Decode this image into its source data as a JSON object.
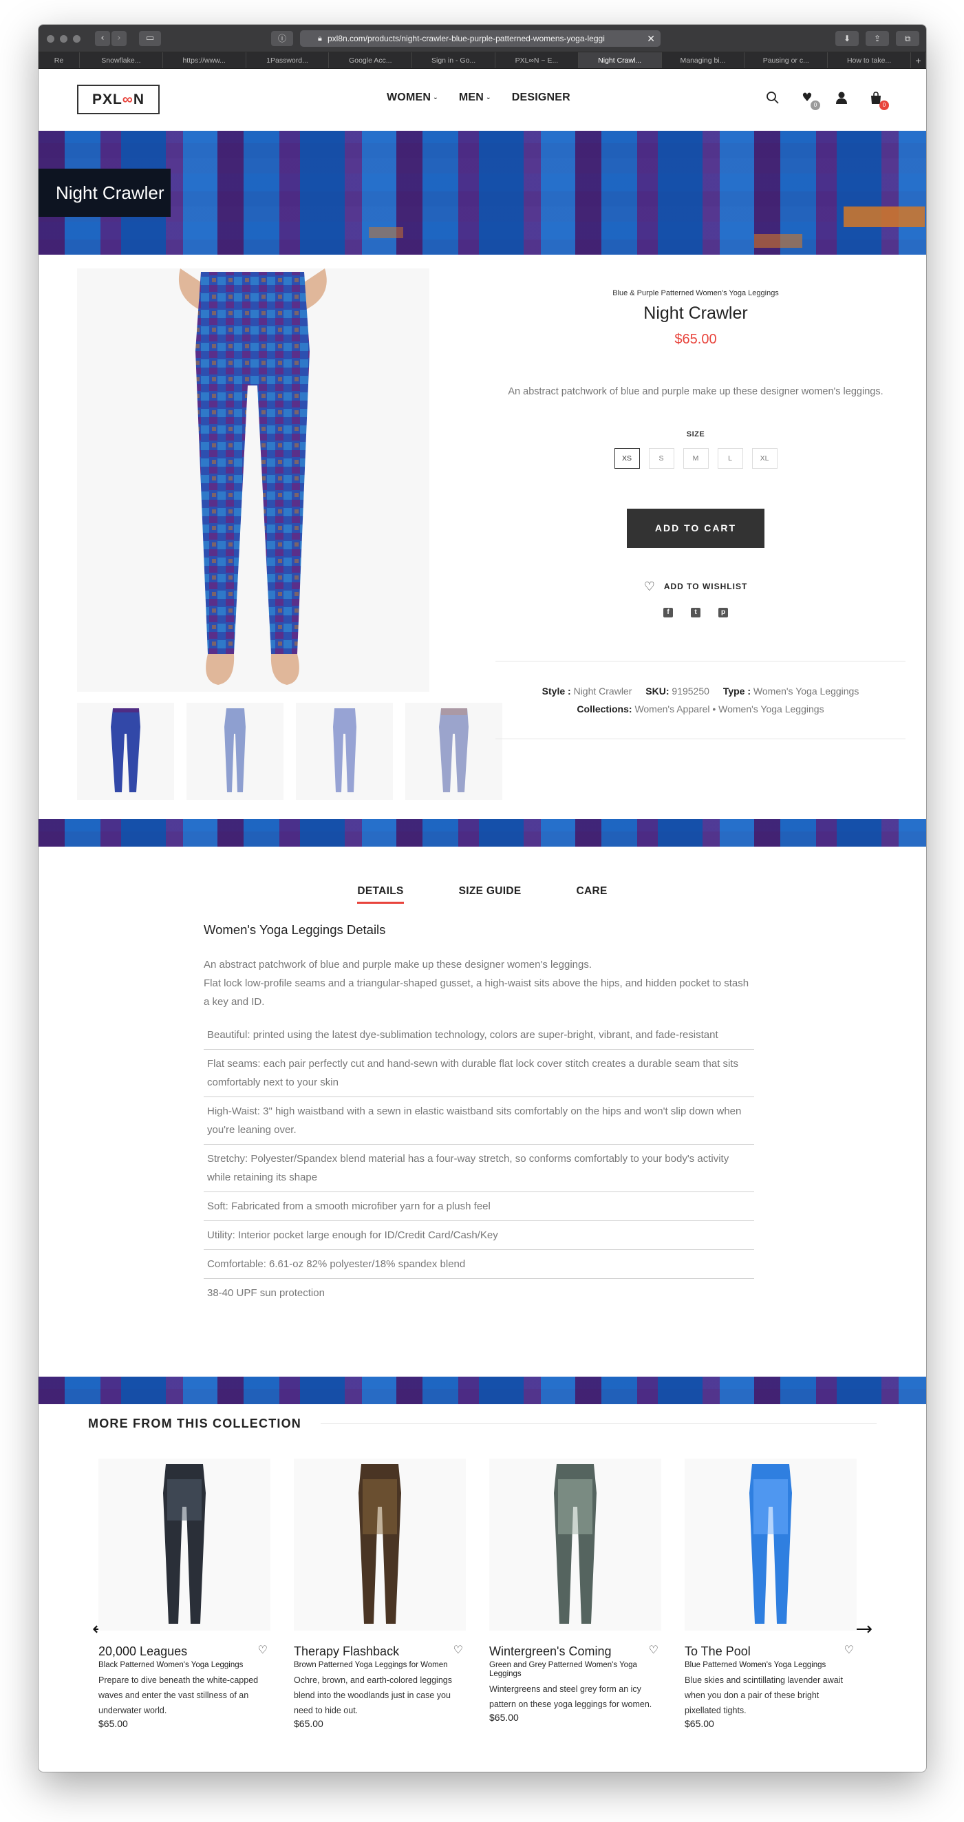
{
  "browser": {
    "url": "pxl8n.com/products/night-crawler-blue-purple-patterned-womens-yoga-leggi",
    "tabs": [
      "Re",
      "Snowflake...",
      "https://www...",
      "1Password...",
      "Google Acc...",
      "Sign in - Go...",
      "PXL∞N ~ E...",
      "Night Crawl...",
      "Managing bi...",
      "Pausing or c...",
      "How to take..."
    ],
    "active_tab_index": 7
  },
  "header": {
    "logo": {
      "prefix": "PXL",
      "mark": "∞",
      "suffix": "N"
    },
    "nav": [
      "WOMEN",
      "MEN",
      "DESIGNER"
    ],
    "wishlist_count": "0",
    "cart_count": "0"
  },
  "hero": {
    "title": "Night Crawler"
  },
  "product": {
    "subtitle": "Blue & Purple Patterned Women's Yoga Leggings",
    "title": "Night Crawler",
    "price": "$65.00",
    "description": "An abstract patchwork of blue and purple make up these designer women's leggings.",
    "size_label": "SIZE",
    "sizes": [
      "XS",
      "S",
      "M",
      "L",
      "XL"
    ],
    "selected_size": "XS",
    "add_to_cart": "ADD TO CART",
    "add_to_wishlist": "ADD TO WISHLIST",
    "meta": {
      "style_label": "Style :",
      "style_value": "Night Crawler",
      "sku_label": "SKU:",
      "sku_value": "9195250",
      "type_label": "Type :",
      "type_value": "Women's Yoga Leggings",
      "collections_label": "Collections:",
      "collections_value": "Women's Apparel • Women's Yoga Leggings"
    }
  },
  "details": {
    "tabs": [
      "DETAILS",
      "SIZE GUIDE",
      "CARE"
    ],
    "heading": "Women's Yoga Leggings Details",
    "intro_1": "An abstract patchwork of blue and purple make up these designer women's leggings.",
    "intro_2": "Flat lock low-profile seams and a triangular-shaped gusset, a high-waist sits above the hips, and hidden pocket to stash a key and ID.",
    "features": [
      "Beautiful: printed using the latest dye-sublimation technology, colors are super-bright, vibrant, and fade-resistant",
      "Flat seams: each pair perfectly cut and hand-sewn with durable flat lock cover stitch creates a durable seam that sits comfortably next to your skin",
      "High-Waist: 3\" high waistband with a sewn in elastic waistband sits comfortably on the hips and won't slip down when you're leaning over.",
      "Stretchy: Polyester/Spandex blend material has a four-way stretch, so conforms comfortably to your body's activity while retaining its shape",
      "Soft: Fabricated from a smooth microfiber yarn for a plush feel",
      "Utility: Interior pocket large enough for ID/Credit Card/Cash/Key",
      "Comfortable: 6.61-oz 82% polyester/18% spandex blend",
      "38-40 UPF sun protection"
    ]
  },
  "collection": {
    "heading": "MORE FROM THIS COLLECTION",
    "items": [
      {
        "title": "20,000 Leagues",
        "subtitle": "Black Patterned Women's Yoga Leggings",
        "description": "Prepare to dive beneath the white-capped waves and enter the vast stillness of an underwater world.",
        "price": "$65.00",
        "color": "#2a2f38"
      },
      {
        "title": "Therapy Flashback",
        "subtitle": "Brown Patterned Yoga Leggings for Women",
        "description": "Ochre, brown, and earth-colored leggings blend into the woodlands just in case you need to hide out.",
        "price": "$65.00",
        "color": "#4a3524"
      },
      {
        "title": "Wintergreen's Coming",
        "subtitle": "Green and Grey Patterned Women's Yoga Leggings",
        "description": "Wintergreens and steel grey form an icy pattern on these yoga leggings for women.",
        "price": "$65.00",
        "color": "#55645f"
      },
      {
        "title": "To The Pool",
        "subtitle": "Blue Patterned Women's Yoga Leggings",
        "description": "Blue skies and scintillating lavender await when you don a pair of these bright pixellated tights.",
        "price": "$65.00",
        "color": "#2f7fe0"
      }
    ]
  },
  "colors": {
    "accent": "#e8443c",
    "dark": "#333333",
    "pattern_blue": "#1f4aa8",
    "pattern_purple": "#46206e"
  }
}
